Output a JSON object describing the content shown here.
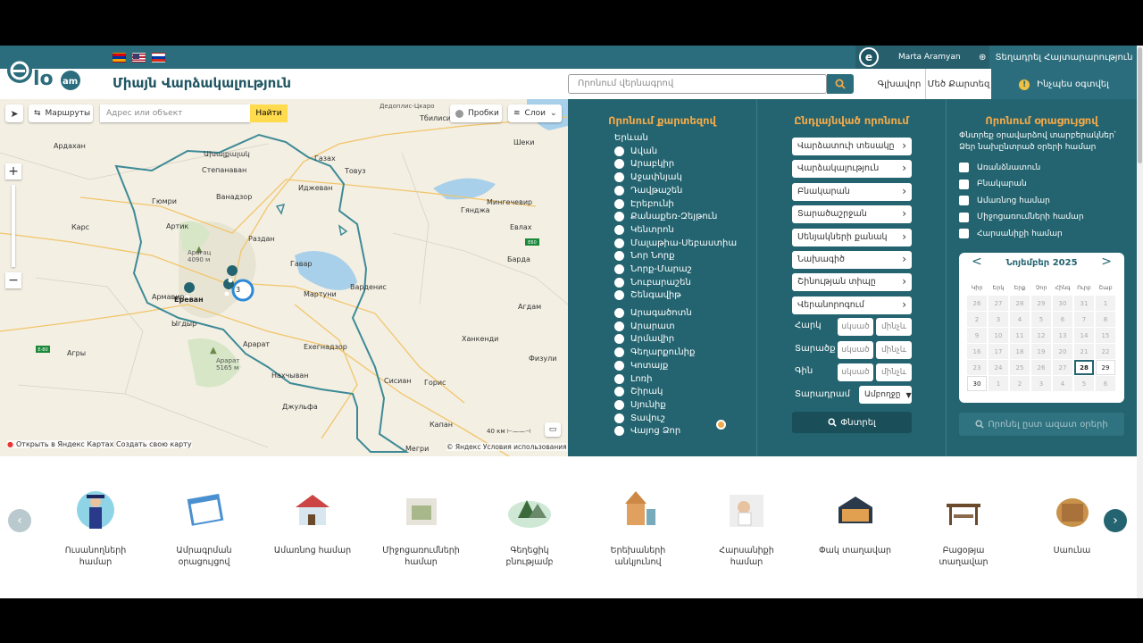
{
  "header": {
    "site_title": "Միայն Վարձակալություն",
    "search_placeholder": "Որոնում վերնագրով",
    "user_name": "Marta Aramyan",
    "announce_label": "Տեղադրել Հայտարարություն",
    "tabs": [
      {
        "label": "Գլխավոր"
      },
      {
        "label": "Մեծ Քարտեզ"
      },
      {
        "label": "Ինչպես օգտվել"
      }
    ],
    "logo_text": "elo.am"
  },
  "map": {
    "routes_label": "Маршруты",
    "address_placeholder": "Адрес или объект",
    "find_label": "Найти",
    "traffic_label": "Пробки",
    "layers_label": "Слои",
    "cluster_count": "3",
    "scale_label": "40 км",
    "open_label": "Открыть в Яндекс Картах",
    "create_label": "Создать свою карту",
    "copyright": "© Яндекс Условия использования",
    "places": [
      {
        "name": "Ереван"
      },
      {
        "name": "Ախալքալակ"
      },
      {
        "name": "Артик"
      },
      {
        "name": "Гюмри"
      },
      {
        "name": "Ванадзор"
      },
      {
        "name": "Степанаван"
      },
      {
        "name": "Раздан"
      },
      {
        "name": "Иджеван"
      },
      {
        "name": "Гавар"
      },
      {
        "name": "Мартуни"
      },
      {
        "name": "Варденис"
      },
      {
        "name": "Армавир"
      },
      {
        "name": "Ыгдыр"
      },
      {
        "name": "Арарат"
      },
      {
        "name": "Ехегнадзор"
      },
      {
        "name": "Сисиан"
      },
      {
        "name": "Горис"
      },
      {
        "name": "Капан"
      },
      {
        "name": "Мегри"
      },
      {
        "name": "Тбилиси"
      },
      {
        "name": "Гянджа"
      },
      {
        "name": "Карс"
      },
      {
        "name": "Агры"
      },
      {
        "name": "Товуз"
      },
      {
        "name": "Газах"
      },
      {
        "name": "Мингечевир"
      },
      {
        "name": "Барда"
      },
      {
        "name": "Агдам"
      },
      {
        "name": "Физули"
      },
      {
        "name": "Ханкенди"
      },
      {
        "name": "Шеки"
      },
      {
        "name": "Евлах"
      },
      {
        "name": "Джульфа"
      },
      {
        "name": "Нахчыван"
      },
      {
        "name": "Дедоплис-Цкаро"
      },
      {
        "name": "Ардахан"
      },
      {
        "name": "Арарат 5165 м"
      },
      {
        "name": "Арагац 4090 м"
      }
    ]
  },
  "filters": {
    "by_map_title": "Որոնում քարտեզով",
    "regions": [
      {
        "label": "Երևան"
      },
      {
        "label": "Ավան"
      },
      {
        "label": "Արաբկիր"
      },
      {
        "label": "Աջափնյակ"
      },
      {
        "label": "Դավթաշեն"
      },
      {
        "label": "Էրեբունի"
      },
      {
        "label": "Քանաքեռ-Զեյթուն"
      },
      {
        "label": "Կենտրոն"
      },
      {
        "label": "Մալաթիա-Սեբաստիա"
      },
      {
        "label": "Նոր Նորք"
      },
      {
        "label": "Նորք-Մարաշ"
      },
      {
        "label": "Նուբարաշեն"
      },
      {
        "label": "Շենգավիթ"
      }
    ],
    "provinces": [
      {
        "label": "Արագածոտն"
      },
      {
        "label": "Արարատ"
      },
      {
        "label": "Արմավիր"
      },
      {
        "label": "Գեղարքունիք"
      },
      {
        "label": "Կոտայք"
      },
      {
        "label": "Լոռի"
      },
      {
        "label": "Շիրակ"
      },
      {
        "label": "Սյունիք"
      },
      {
        "label": "Տավուշ"
      },
      {
        "label": "Վայոց Ձոր"
      }
    ],
    "advanced_title": "Ընդլայնված որոնում",
    "dropdowns": [
      {
        "label": "Վարձատուի տեսակը"
      },
      {
        "label": "Վարձակալություն"
      },
      {
        "label": "Բնակարան"
      },
      {
        "label": "Տարածաշրջան"
      },
      {
        "label": "Սենյակների քանակ"
      },
      {
        "label": "Նախագիծ"
      },
      {
        "label": "Շինության տիպը"
      },
      {
        "label": "Վերանորոգում"
      }
    ],
    "ranges": [
      {
        "label": "Հարկ",
        "from": "սկսած",
        "to": "մինչև"
      },
      {
        "label": "Տարածք",
        "from": "սկսած",
        "to": "մինչև"
      },
      {
        "label": "Գին",
        "from": "սկսած",
        "to": "մինչև"
      }
    ],
    "period_label": "Տարադրամ",
    "period_value": "Ամբողջը",
    "search_label": "Փնտրել",
    "by_calendar_title": "Որոնում օրացույցով",
    "calendar_desc": "Փնտրեք օրավարձով տարբերակներ՝ Ձեր նախընտրած օրերի համար",
    "checkboxes": [
      {
        "label": "Առանձնատուն"
      },
      {
        "label": "Բնակարան"
      },
      {
        "label": "Ամառնոց համար"
      },
      {
        "label": "Միջոցառումների համար"
      },
      {
        "label": "Հարսանիքի համար"
      }
    ],
    "calendar": {
      "month": "Նոյեմբեր 2025",
      "weekdays": [
        "Կիր",
        "Երկ",
        "Երք",
        "Չոր",
        "Հինգ",
        "Ուրբ",
        "Շաբ"
      ],
      "days": [
        "26",
        "27",
        "28",
        "29",
        "30",
        "31",
        "1",
        "2",
        "3",
        "4",
        "5",
        "6",
        "7",
        "8",
        "9",
        "10",
        "11",
        "12",
        "13",
        "14",
        "15",
        "16",
        "17",
        "18",
        "19",
        "20",
        "21",
        "22",
        "23",
        "24",
        "25",
        "26",
        "27",
        "28",
        "29",
        "30",
        "1",
        "2",
        "3",
        "4",
        "5",
        "6"
      ],
      "today": "28"
    },
    "free_days_label": "Որոնել ըստ ազատ օրերի"
  },
  "categories": [
    {
      "label": "Ուսանողների համար"
    },
    {
      "label": "Ամրագրման օրացույցով"
    },
    {
      "label": "Ամառնոց համար"
    },
    {
      "label": "Միջոցառումների համար"
    },
    {
      "label": "Գեղեցիկ բնությամբ"
    },
    {
      "label": "Երեխաների անկյունով"
    },
    {
      "label": "Հարսանիքի համար"
    },
    {
      "label": "Փակ տաղավար"
    },
    {
      "label": "Բացօթյա տաղավար"
    },
    {
      "label": "Սաունա"
    }
  ],
  "colors": {
    "primary": "#236470",
    "accent": "#f0a94a",
    "topbar": "#2b6d7c"
  }
}
